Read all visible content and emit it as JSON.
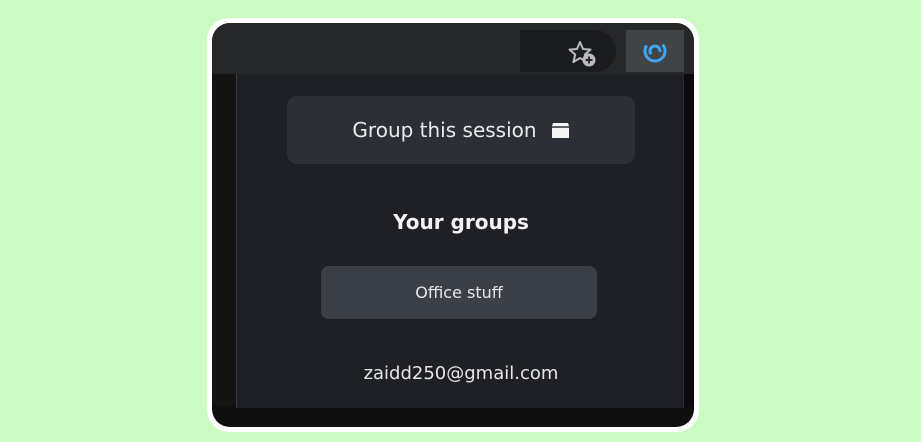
{
  "toolbar": {
    "bookmark_icon": "star-add-icon",
    "extension_icon": "swirl-extension-icon",
    "extension_color": "#3ea6f5"
  },
  "popup": {
    "group_button_label": "Group this session",
    "group_button_icon": "box-icon",
    "groups_heading": "Your groups",
    "groups": [
      {
        "label": "Office stuff"
      }
    ],
    "account_email": "zaidd250@gmail.com"
  },
  "colors": {
    "background": "#ccfcc4",
    "popup_background": "#1e2026",
    "button_background": "#2c2f36",
    "group_item_background": "#3a3f48"
  }
}
